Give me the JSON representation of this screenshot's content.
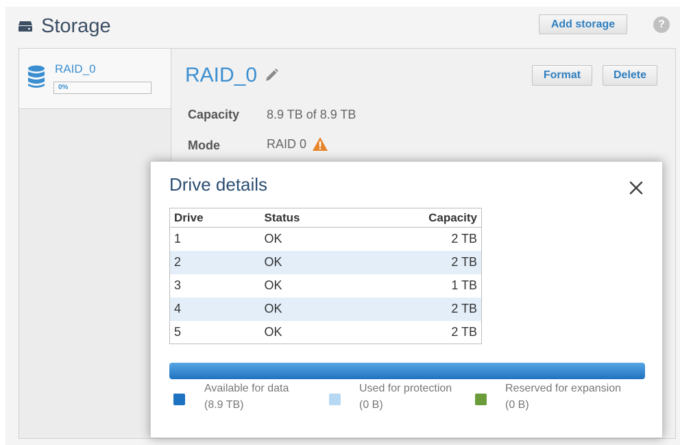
{
  "header": {
    "title": "Storage",
    "add_storage_label": "Add storage",
    "help_label": "?"
  },
  "sidebar": {
    "items": [
      {
        "label": "RAID_0",
        "progress_text": "0%",
        "progress": 0
      }
    ]
  },
  "volume": {
    "title": "RAID_0",
    "format_label": "Format",
    "delete_label": "Delete",
    "capacity_key": "Capacity",
    "capacity_value": "8.9 TB of 8.9 TB",
    "mode_key": "Mode",
    "mode_value": "RAID 0"
  },
  "modal": {
    "title": "Drive details",
    "table": {
      "headers": [
        "Drive",
        "Status",
        "Capacity"
      ],
      "rows": [
        [
          "1",
          "OK",
          "2 TB"
        ],
        [
          "2",
          "OK",
          "2 TB"
        ],
        [
          "3",
          "OK",
          "1 TB"
        ],
        [
          "4",
          "OK",
          "2 TB"
        ],
        [
          "5",
          "OK",
          "2 TB"
        ]
      ]
    },
    "legend": [
      {
        "label": "Available for data",
        "value": "(8.9 TB)",
        "color": "#1e72bf"
      },
      {
        "label": "Used for protection",
        "value": "(0 B)",
        "color": "#b6d8f2"
      },
      {
        "label": "Reserved for expansion",
        "value": "(0 B)",
        "color": "#6a9d3a"
      }
    ]
  },
  "colors": {
    "accent": "#3b8fd1",
    "warning": "#e8842a"
  }
}
